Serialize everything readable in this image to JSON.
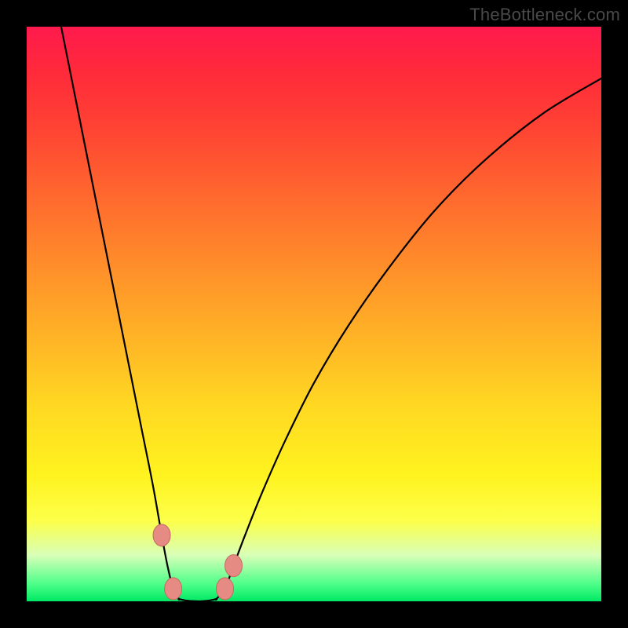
{
  "attribution": "TheBottleneck.com",
  "colors": {
    "frame": "#000000",
    "gradient_top": "#ff1a4d",
    "gradient_bottom": "#00e865",
    "curve_stroke": "#000000",
    "marker_fill": "#e68a84",
    "marker_stroke": "#c46a63"
  },
  "chart_data": {
    "type": "line",
    "title": "",
    "xlabel": "",
    "ylabel": "",
    "xlim": [
      0,
      1
    ],
    "ylim": [
      0,
      1
    ],
    "grid": false,
    "legend": false,
    "series": [
      {
        "name": "left-branch",
        "x": [
          0.06,
          0.08,
          0.1,
          0.12,
          0.14,
          0.16,
          0.18,
          0.2,
          0.22,
          0.235,
          0.245,
          0.255,
          0.265
        ],
        "values": [
          1.0,
          0.9,
          0.8,
          0.7,
          0.6,
          0.5,
          0.4,
          0.3,
          0.2,
          0.115,
          0.062,
          0.022,
          0.004
        ]
      },
      {
        "name": "right-branch",
        "x": [
          0.33,
          0.345,
          0.36,
          0.38,
          0.41,
          0.45,
          0.5,
          0.56,
          0.63,
          0.71,
          0.8,
          0.9,
          1.0
        ],
        "values": [
          0.004,
          0.022,
          0.062,
          0.115,
          0.19,
          0.28,
          0.38,
          0.48,
          0.58,
          0.68,
          0.77,
          0.85,
          0.91
        ]
      },
      {
        "name": "valley-floor",
        "x": [
          0.265,
          0.28,
          0.3,
          0.315,
          0.33
        ],
        "values": [
          0.004,
          0.001,
          0.0,
          0.001,
          0.004
        ]
      }
    ],
    "markers": [
      {
        "name": "left-upper",
        "x": 0.235,
        "y": 0.115
      },
      {
        "name": "left-lower",
        "x": 0.255,
        "y": 0.022
      },
      {
        "name": "right-lower",
        "x": 0.345,
        "y": 0.022
      },
      {
        "name": "right-upper",
        "x": 0.36,
        "y": 0.062
      }
    ]
  }
}
